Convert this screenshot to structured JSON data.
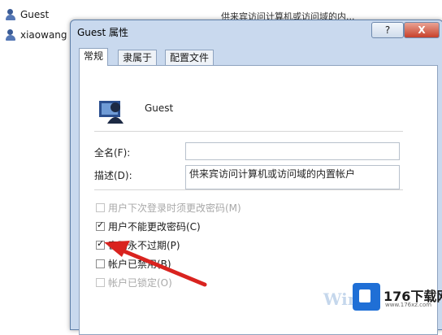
{
  "background": {
    "rows": [
      {
        "name": "Guest",
        "desc": "供来宾访问计算机或访问域的内..."
      },
      {
        "name": "xiaowang",
        "desc": ""
      }
    ]
  },
  "dialog": {
    "title": "Guest 属性",
    "help_label": "?",
    "close_label": "X",
    "tabs": [
      "常规",
      "隶属于",
      "配置文件"
    ],
    "user_name": "Guest",
    "fullname_label": "全名(F):",
    "fullname_value": "",
    "desc_label": "描述(D):",
    "desc_value": "供来宾访问计算机或访问域的内置帐户",
    "checkboxes": [
      {
        "label": "用户下次登录时须更改密码(M)",
        "checked": false,
        "disabled": true
      },
      {
        "label": "用户不能更改密码(C)",
        "checked": true,
        "disabled": false
      },
      {
        "label": "密码永不过期(P)",
        "checked": true,
        "disabled": false
      },
      {
        "label": "帐户已禁用(B)",
        "checked": false,
        "disabled": false
      },
      {
        "label": "帐户已锁定(O)",
        "checked": false,
        "disabled": true
      }
    ]
  },
  "watermark": {
    "site": "176下载网",
    "url": "www.176xz.com",
    "win_text": "Win"
  },
  "colors": {
    "arrow": "#d9231f",
    "title_bar": "#c9d9ee",
    "close_button": "#c7412b"
  }
}
